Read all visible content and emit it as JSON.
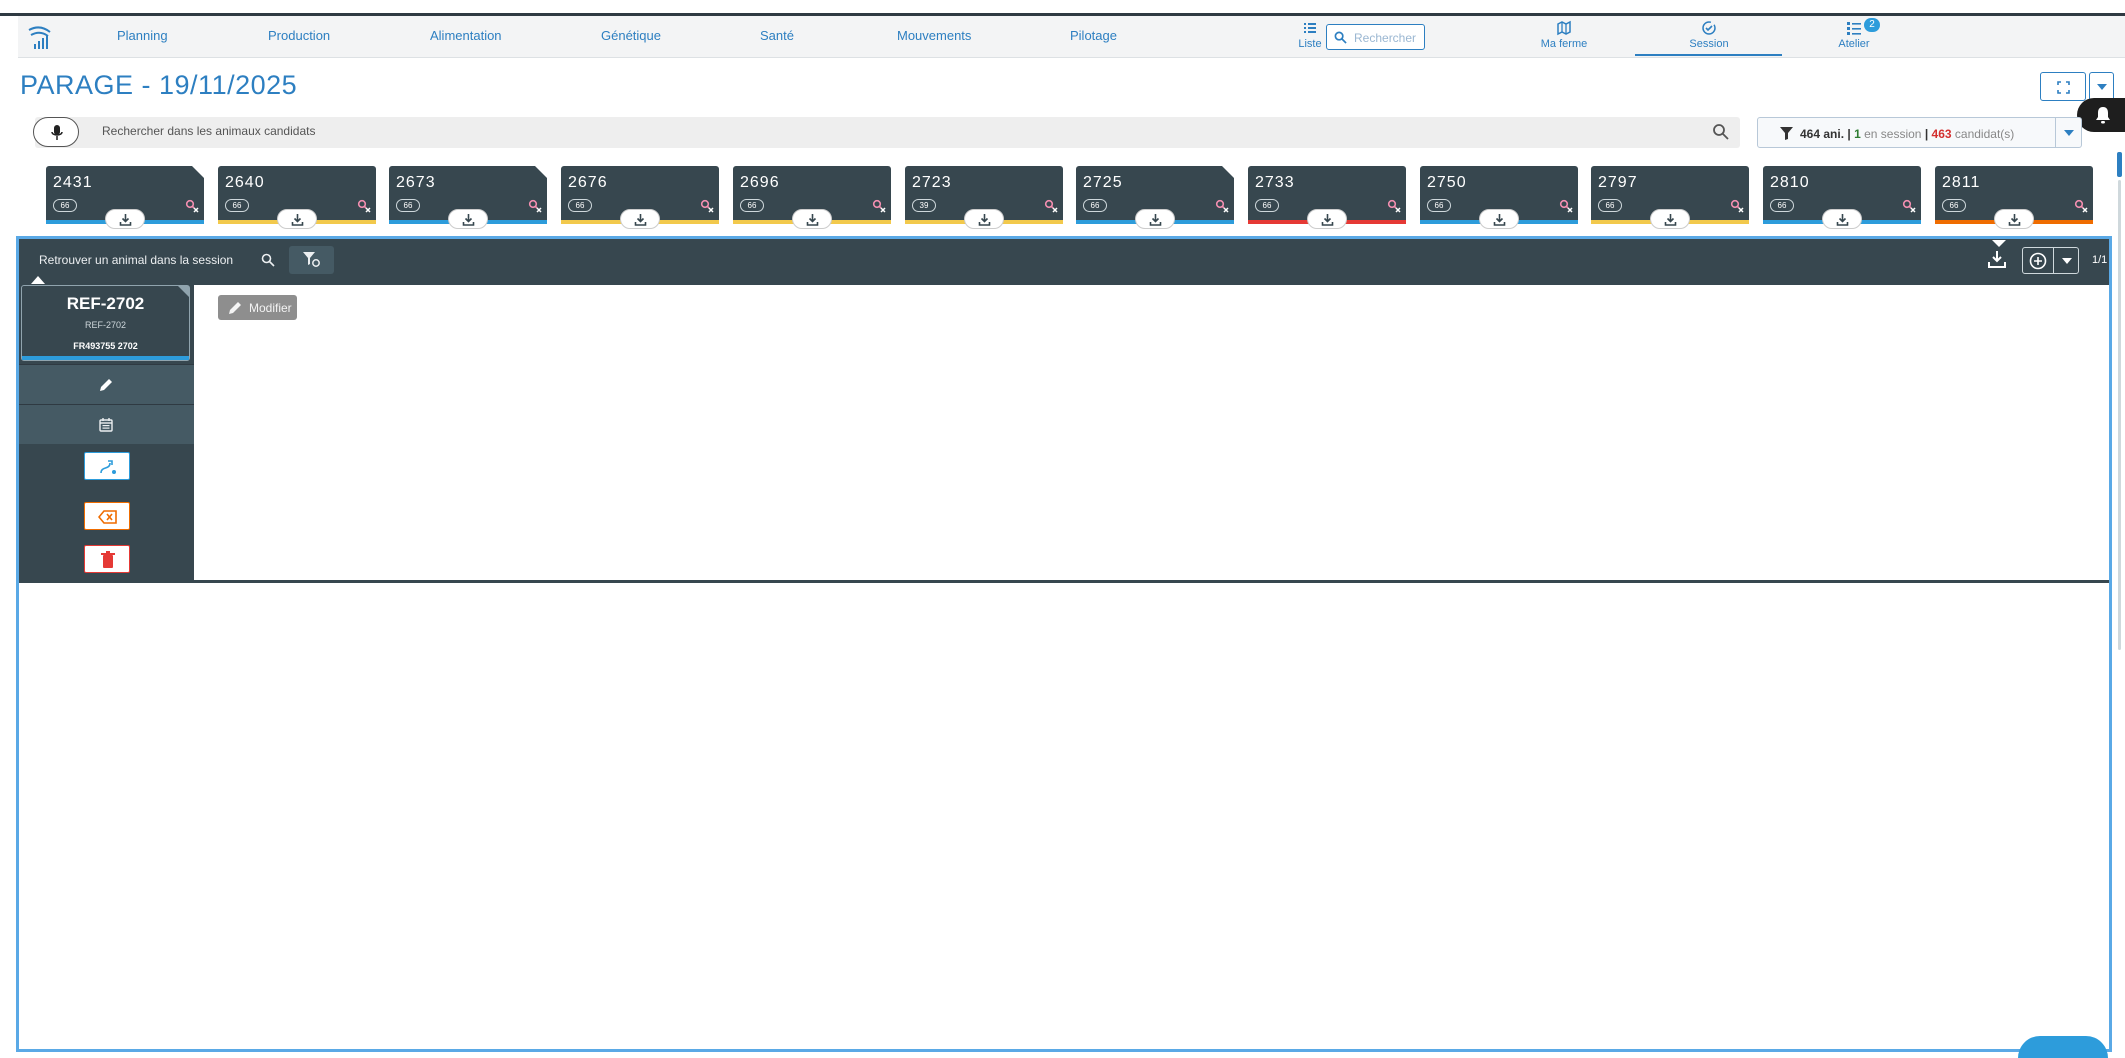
{
  "nav": {
    "items": [
      "Planning",
      "Production",
      "Alimentation",
      "Génétique",
      "Santé",
      "Mouvements",
      "Pilotage"
    ],
    "liste_label": "Liste",
    "search_placeholder": "Rechercher",
    "ma_ferme_label": "Ma ferme",
    "session_label": "Session",
    "atelier_label": "Atelier",
    "atelier_badge": "2"
  },
  "page": {
    "title": "PARAGE - 19/11/2025"
  },
  "search": {
    "placeholder": "Rechercher dans les animaux candidats"
  },
  "filter": {
    "total": "464 ani.",
    "sep1": "|",
    "in_session_count": "1",
    "in_session_label": "en session",
    "sep2": "|",
    "candidates_count": "463",
    "candidates_label": "candidat(s)"
  },
  "cards": [
    {
      "num": "2431",
      "pill": "66",
      "bar": "#2d9cdb",
      "corner": true
    },
    {
      "num": "2640",
      "pill": "66",
      "bar": "#f2c94c",
      "corner": false
    },
    {
      "num": "2673",
      "pill": "66",
      "bar": "#2d9cdb",
      "corner": true
    },
    {
      "num": "2676",
      "pill": "66",
      "bar": "#f2c94c",
      "corner": false
    },
    {
      "num": "2696",
      "pill": "66",
      "bar": "#f2c94c",
      "corner": false
    },
    {
      "num": "2723",
      "pill": "39",
      "bar": "#f2c94c",
      "corner": false
    },
    {
      "num": "2725",
      "pill": "66",
      "bar": "#2d9cdb",
      "corner": true
    },
    {
      "num": "2733",
      "pill": "66",
      "bar": "#e53935",
      "corner": false
    },
    {
      "num": "2750",
      "pill": "66",
      "bar": "#2d9cdb",
      "corner": false
    },
    {
      "num": "2797",
      "pill": "66",
      "bar": "#f2c94c",
      "corner": false
    },
    {
      "num": "2810",
      "pill": "66",
      "bar": "#2d9cdb",
      "corner": false
    },
    {
      "num": "2811",
      "pill": "66",
      "bar": "#ef6c00",
      "corner": false
    }
  ],
  "session": {
    "search_placeholder": "Retrouver un animal dans la session",
    "page_count": "1/1",
    "animal": {
      "ref": "REF-2702",
      "sub": "REF-2702",
      "id": "FR493755  2702"
    },
    "modify_label": "Modifier"
  },
  "colors": {
    "primary": "#2d7fc1",
    "dark": "#37474f",
    "accent_blue": "#2d9cdb",
    "yellow": "#f2c94c",
    "red": "#e53935",
    "orange": "#ef6c00"
  }
}
